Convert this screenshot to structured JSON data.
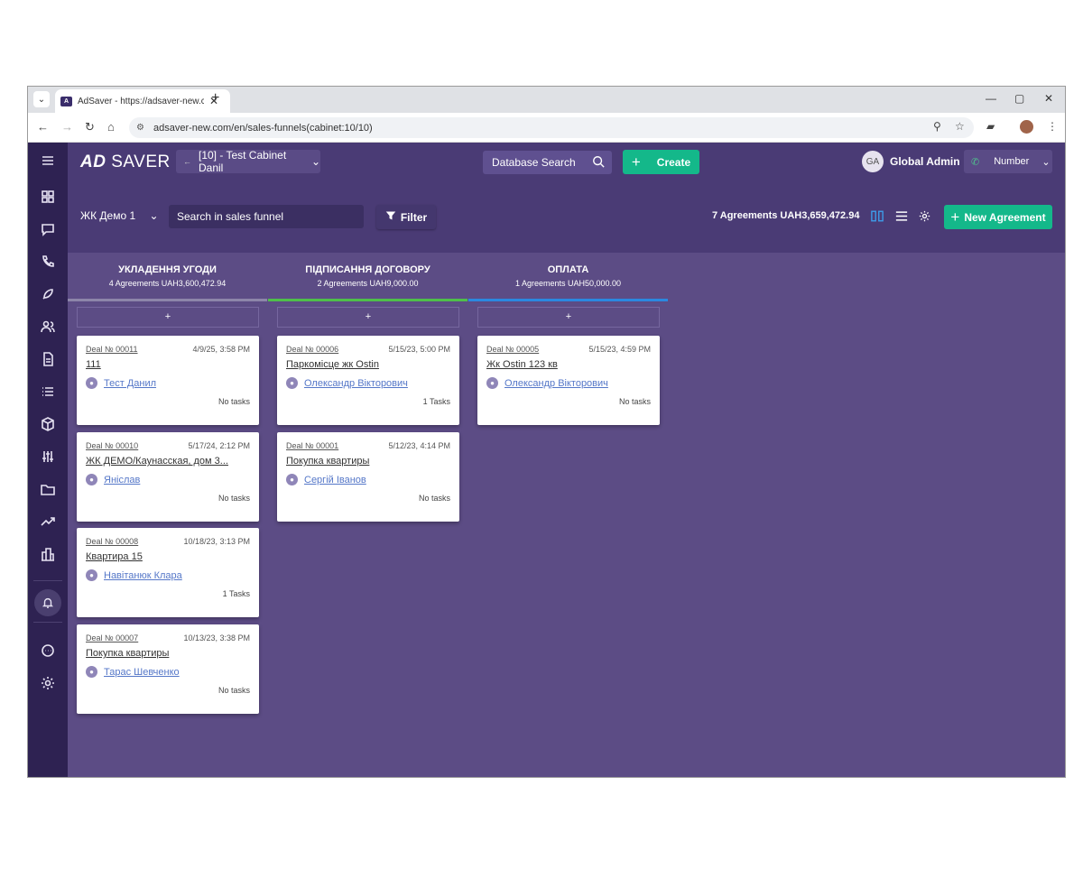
{
  "browser": {
    "tab_title": "AdSaver - https://adsaver-new.c",
    "url": "adsaver-new.com/en/sales-funnels(cabinet:10/10)"
  },
  "topbar": {
    "logo_left": "A",
    "logo_right": "SAVER",
    "cabinet": "[10] - Test Cabinet Danil",
    "database_search": "Database Search",
    "create_label": "Create",
    "user_initials": "GA",
    "user_name": "Global Admin",
    "number_label": "Number"
  },
  "subbar": {
    "funnel": "ЖК Демо 1",
    "search_placeholder": "Search in sales funnel",
    "filter_label": "Filter",
    "summary": "7 Agreements UAH3,659,472.94",
    "new_agreement_label": "New Agreement"
  },
  "columns": [
    {
      "name": "УКЛАДЕННЯ УГОДИ",
      "summary": "4 Agreements UAH3,600,472.94",
      "color": "#8d85aa",
      "add": "+",
      "cards": [
        {
          "deal": "Deal № 00011",
          "date": "4/9/25, 3:58 PM",
          "title": "111",
          "person": "Тест Данил",
          "tasks": "No tasks"
        },
        {
          "deal": "Deal № 00010",
          "date": "5/17/24, 2:12 PM",
          "title": "ЖК ДЕМО/Каунасская, дом 3...",
          "person": "Яніслав",
          "tasks": "No tasks"
        },
        {
          "deal": "Deal № 00008",
          "date": "10/18/23, 3:13 PM",
          "title": "Квартира 15",
          "person": "Навітанюк Клара",
          "tasks": "1 Tasks"
        },
        {
          "deal": "Deal № 00007",
          "date": "10/13/23, 3:38 PM",
          "title": "Покупка квартиры",
          "person": "Тарас Шевченко",
          "tasks": "No tasks"
        }
      ]
    },
    {
      "name": "ПІДПИСАННЯ ДОГОВОРУ",
      "summary": "2 Agreements UAH9,000.00",
      "color": "#4fbf4a",
      "add": "+",
      "cards": [
        {
          "deal": "Deal № 00006",
          "date": "5/15/23, 5:00 PM",
          "title": "Паркомісце жк Ostin",
          "person": "Олександр Вікторович",
          "tasks": "1 Tasks"
        },
        {
          "deal": "Deal № 00001",
          "date": "5/12/23, 4:14 PM",
          "title": "Покупка квартиры",
          "person": "Сергій Іванов",
          "tasks": "No tasks"
        }
      ]
    },
    {
      "name": "ОПЛАТА",
      "summary": "1 Agreements UAH50,000.00",
      "color": "#2b88e0",
      "add": "+",
      "cards": [
        {
          "deal": "Deal № 00005",
          "date": "5/15/23, 4:59 PM",
          "title": "Жк Ostin 123 кв",
          "person": "Олександр Вікторович",
          "tasks": "No tasks"
        }
      ]
    }
  ]
}
